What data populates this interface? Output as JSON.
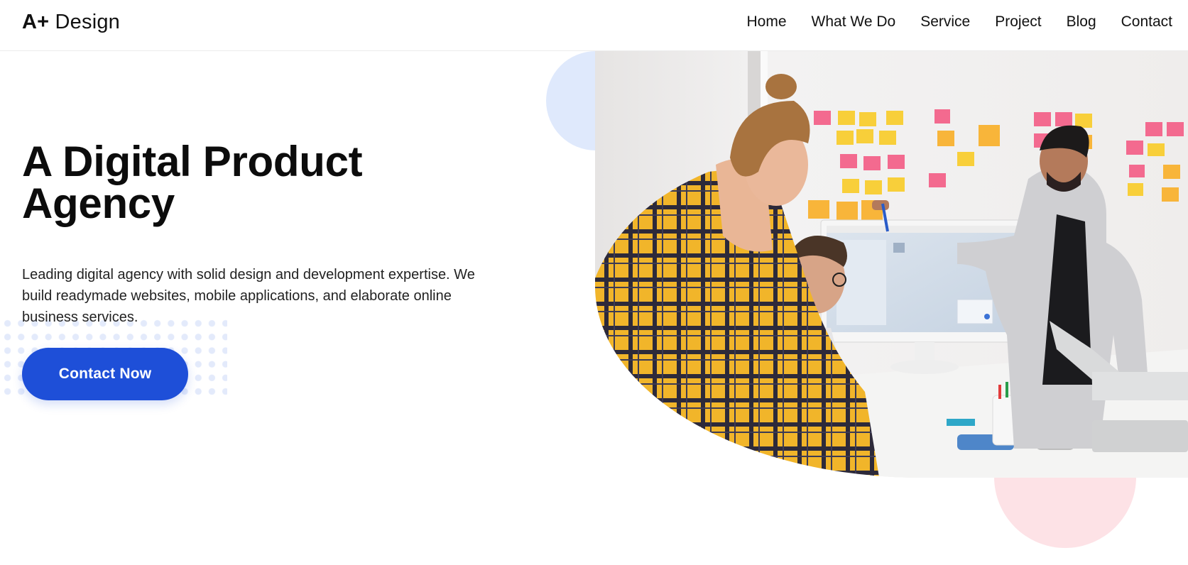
{
  "header": {
    "logo_mark": "A+",
    "logo_text": " Design",
    "nav": [
      {
        "label": "Home"
      },
      {
        "label": "What We Do"
      },
      {
        "label": "Service"
      },
      {
        "label": "Project"
      },
      {
        "label": "Blog"
      },
      {
        "label": "Contact"
      }
    ]
  },
  "hero": {
    "title_line1": "A Digital Product",
    "title_line2": "Agency",
    "description": "Leading digital agency with solid design and development expertise. We build readymade websites, mobile applications, and elaborate online business services.",
    "cta_label": "Contact Now"
  },
  "colors": {
    "primary": "#1e4fd8",
    "accent_blue_soft": "#dfe9fc",
    "accent_pink_soft": "#fde2e6",
    "text": "#111111"
  }
}
